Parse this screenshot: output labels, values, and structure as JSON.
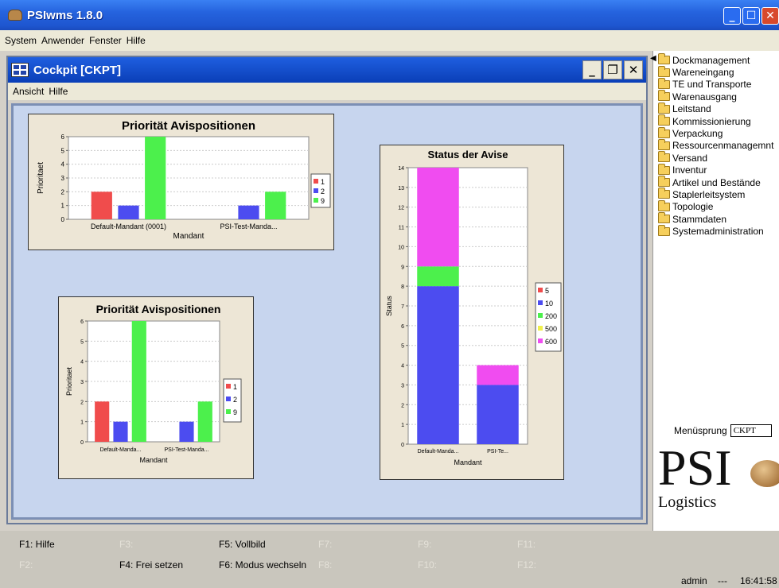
{
  "window": {
    "title": "PSIwms 1.8.0"
  },
  "menubar": [
    "System",
    "Anwender",
    "Fenster",
    "Hilfe"
  ],
  "internal_window": {
    "title": "Cockpit [CKPT]",
    "menu": [
      "Ansicht",
      "Hilfe"
    ]
  },
  "charts": [
    {
      "type": "bar",
      "title": "Priorität Avispositionen",
      "xlabel": "Mandant",
      "ylabel": "Prioritaet",
      "categories": [
        "Default-Mandant (0001)",
        "PSI-Test-Manda..."
      ],
      "ylim": [
        0,
        6
      ],
      "series": [
        {
          "name": "1",
          "color": "#f04c4c",
          "values": [
            2,
            0
          ]
        },
        {
          "name": "2",
          "color": "#4c4cf0",
          "values": [
            1,
            1
          ]
        },
        {
          "name": "9",
          "color": "#4cf04c",
          "values": [
            6,
            2
          ]
        }
      ]
    },
    {
      "type": "bar",
      "title": "Priorität Avispositionen",
      "xlabel": "Mandant",
      "ylabel": "Prioritaet",
      "categories": [
        "Default-Manda...",
        "PSI-Test-Manda..."
      ],
      "ylim": [
        0,
        6
      ],
      "series": [
        {
          "name": "1",
          "color": "#f04c4c",
          "values": [
            2,
            0
          ]
        },
        {
          "name": "2",
          "color": "#4c4cf0",
          "values": [
            1,
            1
          ]
        },
        {
          "name": "9",
          "color": "#4cf04c",
          "values": [
            6,
            2
          ]
        }
      ]
    },
    {
      "type": "bar",
      "stacked": true,
      "title": "Status der Avise",
      "xlabel": "Mandant",
      "ylabel": "Status",
      "categories": [
        "Default-Manda...",
        "PSI-Te..."
      ],
      "ylim": [
        0,
        14
      ],
      "series": [
        {
          "name": "5",
          "color": "#f04c4c",
          "values": [
            0,
            0
          ]
        },
        {
          "name": "10",
          "color": "#4c4cf0",
          "values": [
            8,
            3
          ]
        },
        {
          "name": "200",
          "color": "#4cf04c",
          "values": [
            1,
            0
          ]
        },
        {
          "name": "500",
          "color": "#f0f04c",
          "values": [
            0,
            0
          ]
        },
        {
          "name": "600",
          "color": "#f04cf0",
          "values": [
            5,
            1
          ]
        }
      ]
    }
  ],
  "chart_data": [
    {
      "type": "bar",
      "title": "Priorität Avispositionen",
      "xlabel": "Mandant",
      "ylabel": "Prioritaet",
      "categories": [
        "Default-Mandant (0001)",
        "PSI-Test-Manda..."
      ],
      "ylim": [
        0,
        6
      ],
      "series": [
        {
          "name": "1",
          "values": [
            2,
            0
          ]
        },
        {
          "name": "2",
          "values": [
            1,
            1
          ]
        },
        {
          "name": "9",
          "values": [
            6,
            2
          ]
        }
      ]
    },
    {
      "type": "bar",
      "title": "Priorität Avispositionen",
      "xlabel": "Mandant",
      "ylabel": "Prioritaet",
      "categories": [
        "Default-Manda...",
        "PSI-Test-Manda..."
      ],
      "ylim": [
        0,
        6
      ],
      "series": [
        {
          "name": "1",
          "values": [
            2,
            0
          ]
        },
        {
          "name": "2",
          "values": [
            1,
            1
          ]
        },
        {
          "name": "9",
          "values": [
            6,
            2
          ]
        }
      ]
    },
    {
      "type": "bar",
      "stacked": true,
      "title": "Status der Avise",
      "xlabel": "Mandant",
      "ylabel": "Status",
      "categories": [
        "Default-Manda...",
        "PSI-Te..."
      ],
      "ylim": [
        0,
        14
      ],
      "series": [
        {
          "name": "5",
          "values": [
            0,
            0
          ]
        },
        {
          "name": "10",
          "values": [
            8,
            3
          ]
        },
        {
          "name": "200",
          "values": [
            1,
            0
          ]
        },
        {
          "name": "500",
          "values": [
            0,
            0
          ]
        },
        {
          "name": "600",
          "values": [
            5,
            1
          ]
        }
      ]
    }
  ],
  "tree": {
    "items": [
      "Dockmanagement",
      "Wareneingang",
      "TE und Transporte",
      "Warenausgang",
      "Leitstand",
      "Kommissionierung",
      "Verpackung",
      "Ressourcenmanagemnt",
      "Versand",
      "Inventur",
      "Artikel und Bestände",
      "Staplerleitsystem",
      "Topologie",
      "Stammdaten",
      "Systemadministration"
    ]
  },
  "menusprung": {
    "label": "Menüsprung",
    "value": "CKPT"
  },
  "logo": {
    "text": "PSI",
    "sub": "Logistics"
  },
  "fkeys": {
    "f1": "F1: Hilfe",
    "f2": "F2:",
    "f3": "F3:",
    "f4": "F4: Frei setzen",
    "f5": "F5: Vollbild",
    "f6": "F6: Modus wechseln",
    "f7": "F7:",
    "f8": "F8:",
    "f9": "F9:",
    "f10": "F10:",
    "f11": "F11:",
    "f12": "F12:"
  },
  "status": {
    "user": "admin",
    "sep": "---",
    "time": "16:41:58"
  }
}
